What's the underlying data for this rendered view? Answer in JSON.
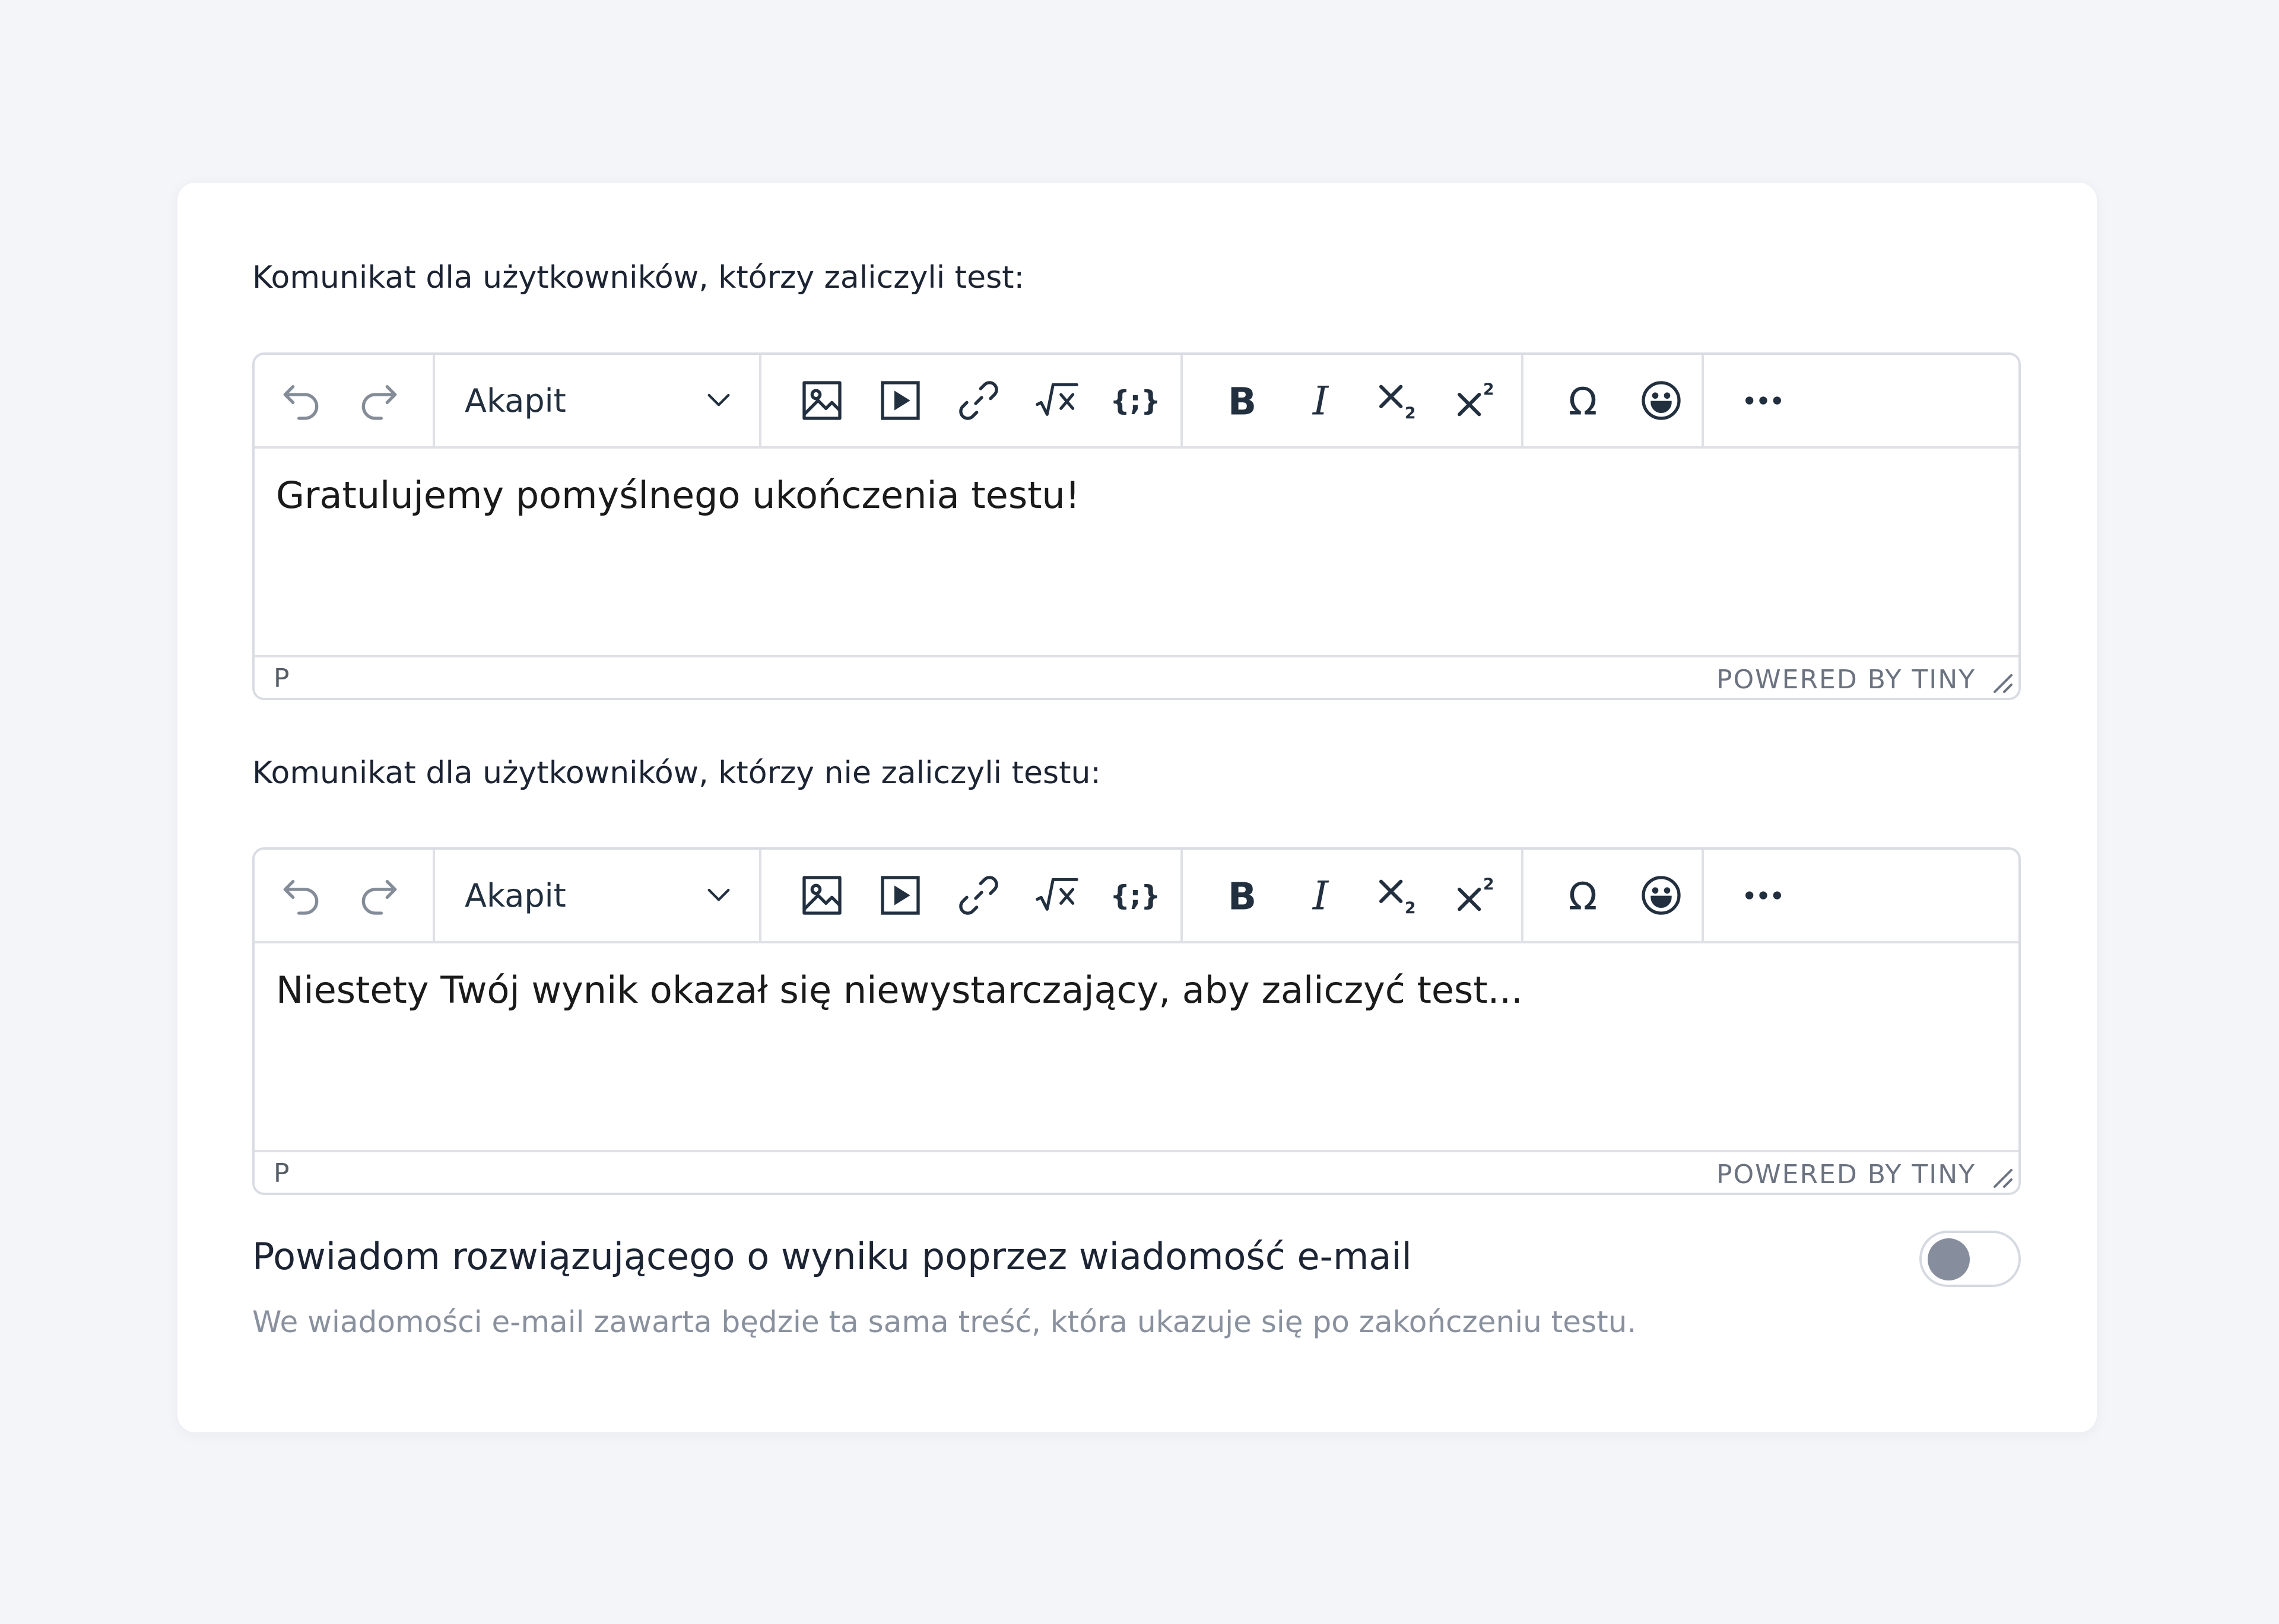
{
  "passed": {
    "label": "Komunikat dla użytkowników, którzy zaliczyli test:",
    "block_format": "Akapit",
    "content": "Gratulujemy pomyślnego ukończenia testu!",
    "path": "P",
    "powered_by": "POWERED BY TINY"
  },
  "failed": {
    "label": "Komunikat dla użytkowników, którzy nie zaliczyli testu:",
    "block_format": "Akapit",
    "content": "Niestety Twój wynik okazał się niewystarczający, aby zaliczyć test...",
    "path": "P",
    "powered_by": "POWERED BY TINY"
  },
  "toolbar_icons": [
    "undo-icon",
    "redo-icon",
    "chevron-down-icon",
    "image-icon",
    "media-icon",
    "link-icon",
    "math-equation-icon",
    "code-braces-icon",
    "bold-icon",
    "italic-icon",
    "subscript-icon",
    "superscript-icon",
    "omega-icon",
    "emoji-icon",
    "more-icon"
  ],
  "email_notify": {
    "label": "Powiadom rozwiązującego o wyniku poprzez wiadomość e-mail",
    "description": "We wiadomości e-mail zawarta będzie ta sama treść, która ukazuje się po zakończeniu testu.",
    "enabled": false
  },
  "colors": {
    "background": "#f4f5f9",
    "card": "#ffffff",
    "toggle_knob": "#868e9d",
    "icon": "#222f3e",
    "muted_text": "#8a919e"
  }
}
